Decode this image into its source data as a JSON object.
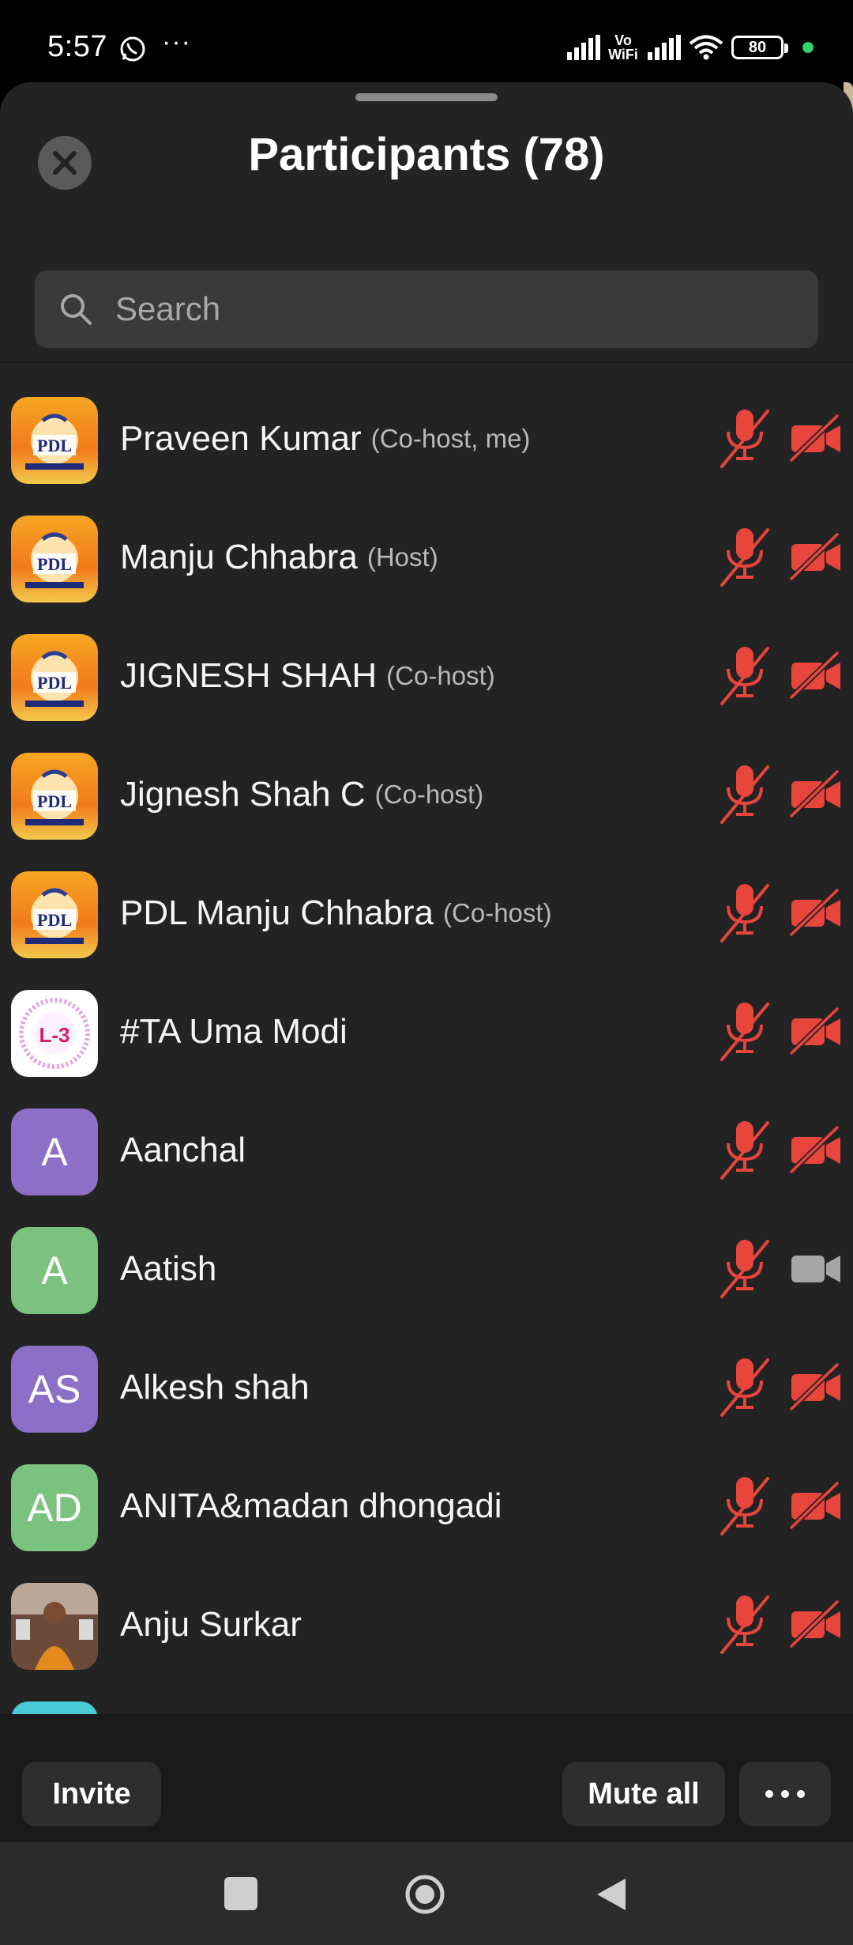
{
  "status_bar": {
    "time": "5:57",
    "overflow": "···",
    "network_label_top": "Vo",
    "network_label_bottom": "WiFi",
    "battery": "80",
    "icons": [
      "whatsapp-icon",
      "signal-icon",
      "wifi-icon",
      "battery-icon"
    ]
  },
  "header": {
    "title": "Participants (78)",
    "close_icon": "close-icon"
  },
  "search": {
    "placeholder": "Search",
    "value": ""
  },
  "participants": [
    {
      "name": "Praveen Kumar",
      "role": "(Co-host, me)",
      "avatar": "pdl-logo",
      "mic": "muted",
      "camera": "off"
    },
    {
      "name": "Manju Chhabra",
      "role": "(Host)",
      "avatar": "pdl-logo",
      "mic": "muted",
      "camera": "off"
    },
    {
      "name": "JIGNESH SHAH",
      "role": "(Co-host)",
      "avatar": "pdl-logo",
      "mic": "muted",
      "camera": "off"
    },
    {
      "name": "Jignesh Shah C",
      "role": "(Co-host)",
      "avatar": "pdl-logo",
      "mic": "muted",
      "camera": "off"
    },
    {
      "name": "PDL Manju Chhabra",
      "role": "(Co-host)",
      "avatar": "pdl-logo",
      "mic": "muted",
      "camera": "off"
    },
    {
      "name": "#TA Uma Modi",
      "role": "",
      "avatar": "l3-logo",
      "avatar_text": "L-3",
      "mic": "muted",
      "camera": "off"
    },
    {
      "name": "Aanchal",
      "role": "",
      "avatar": "initials",
      "initials": "A",
      "color": "#8e6fc7",
      "mic": "muted",
      "camera": "off"
    },
    {
      "name": "Aatish",
      "role": "",
      "avatar": "initials",
      "initials": "A",
      "color": "#7cc27f",
      "mic": "muted",
      "camera": "available"
    },
    {
      "name": "Alkesh shah",
      "role": "",
      "avatar": "initials",
      "initials": "AS",
      "color": "#8e6fc7",
      "mic": "muted",
      "camera": "off"
    },
    {
      "name": "ANITA&madan dhongadi",
      "role": "",
      "avatar": "initials",
      "initials": "AD",
      "color": "#7cc27f",
      "mic": "muted",
      "camera": "off"
    },
    {
      "name": "Anju Surkar",
      "role": "",
      "avatar": "photo",
      "mic": "muted",
      "camera": "off"
    }
  ],
  "actions": {
    "invite": "Invite",
    "mute_all": "Mute all",
    "more": "···"
  },
  "nav": {
    "icons": [
      "recents-icon",
      "home-icon",
      "back-icon"
    ]
  },
  "colors": {
    "muted_red": "#e8453c",
    "camera_gray": "#a6a6a6",
    "sheet_bg": "#232323",
    "search_bg": "#3a3a3a"
  }
}
